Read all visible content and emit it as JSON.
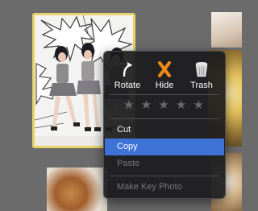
{
  "menu": {
    "actions": [
      {
        "label": "Rotate",
        "icon": "rotate-icon"
      },
      {
        "label": "Hide",
        "icon": "hide-icon"
      },
      {
        "label": "Trash",
        "icon": "trash-icon"
      }
    ],
    "rating": {
      "value": 0,
      "max": 5,
      "glyph": "★"
    },
    "items": [
      {
        "label": "Cut",
        "enabled": true,
        "selected": false
      },
      {
        "label": "Copy",
        "enabled": true,
        "selected": true
      },
      {
        "label": "Paste",
        "enabled": false,
        "selected": false
      },
      {
        "label": "Make Key Photo",
        "enabled": false,
        "selected": false
      }
    ]
  },
  "colors": {
    "selection": "#3e72d6",
    "hide_icon": "#f08a1c",
    "photo_border": "#e8d26a",
    "background": "#6b6b6b"
  }
}
